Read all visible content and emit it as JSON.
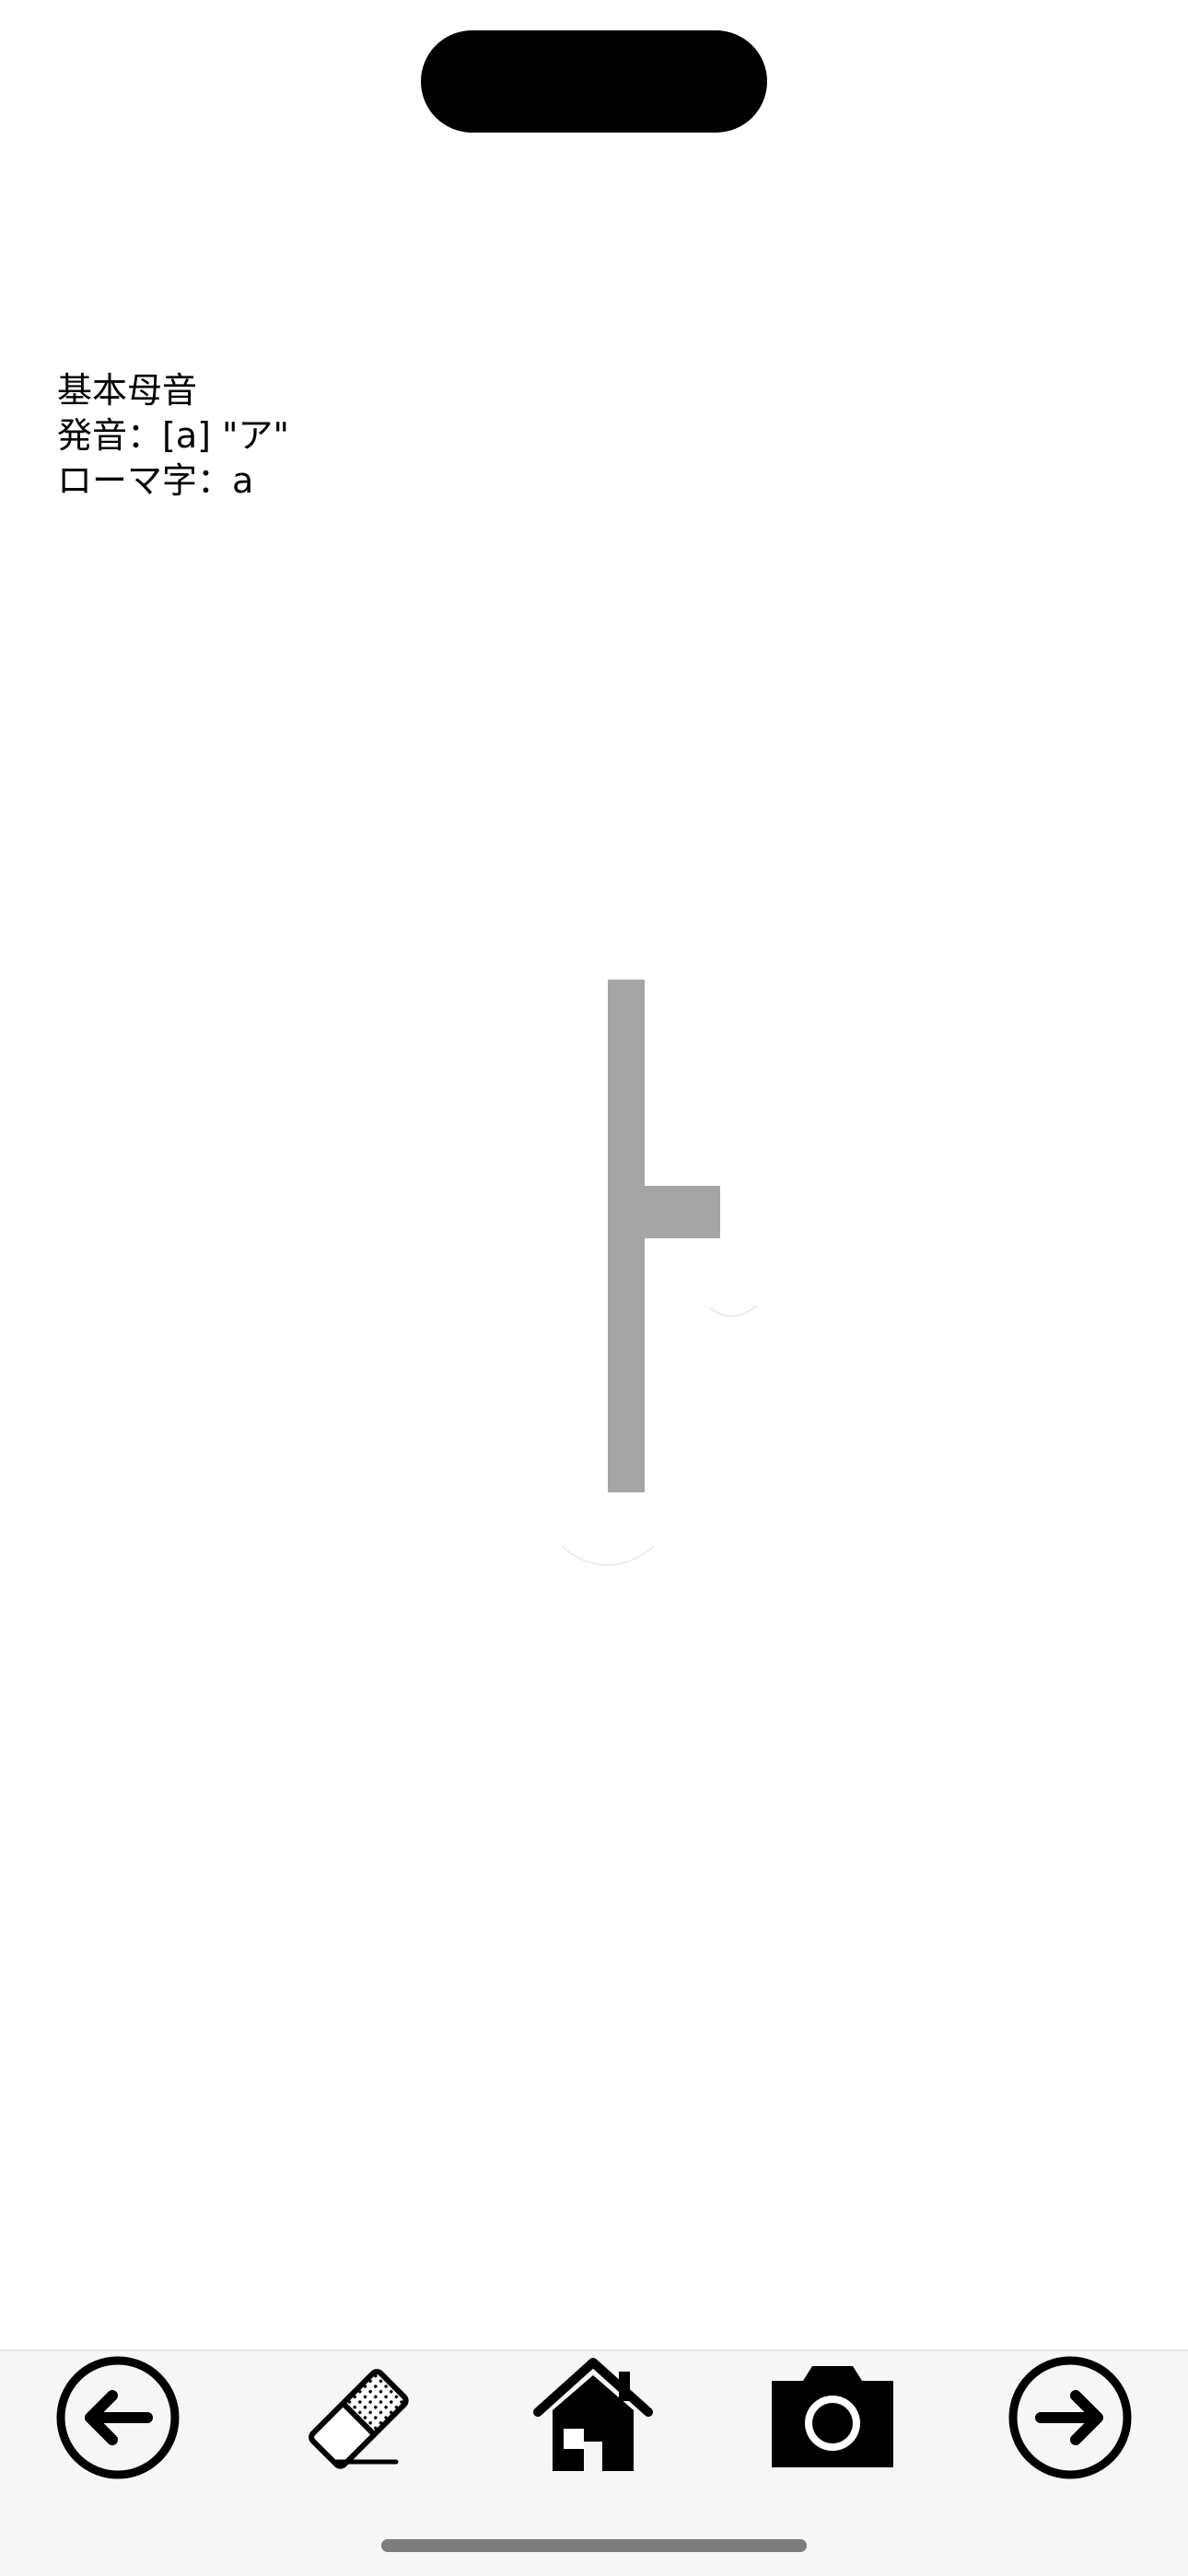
{
  "lesson": {
    "category": "基本母音",
    "pronunciation": "発音：[a] \"ア\"",
    "romaji": "ローマ字：a",
    "glyph_color": "#a5a5a5"
  },
  "toolbar": {
    "items": [
      {
        "name": "back",
        "icon": "arrow-left-circle-icon"
      },
      {
        "name": "erase",
        "icon": "eraser-icon"
      },
      {
        "name": "home",
        "icon": "home-icon"
      },
      {
        "name": "capture",
        "icon": "camera-icon"
      },
      {
        "name": "next",
        "icon": "arrow-right-circle-icon"
      }
    ]
  }
}
